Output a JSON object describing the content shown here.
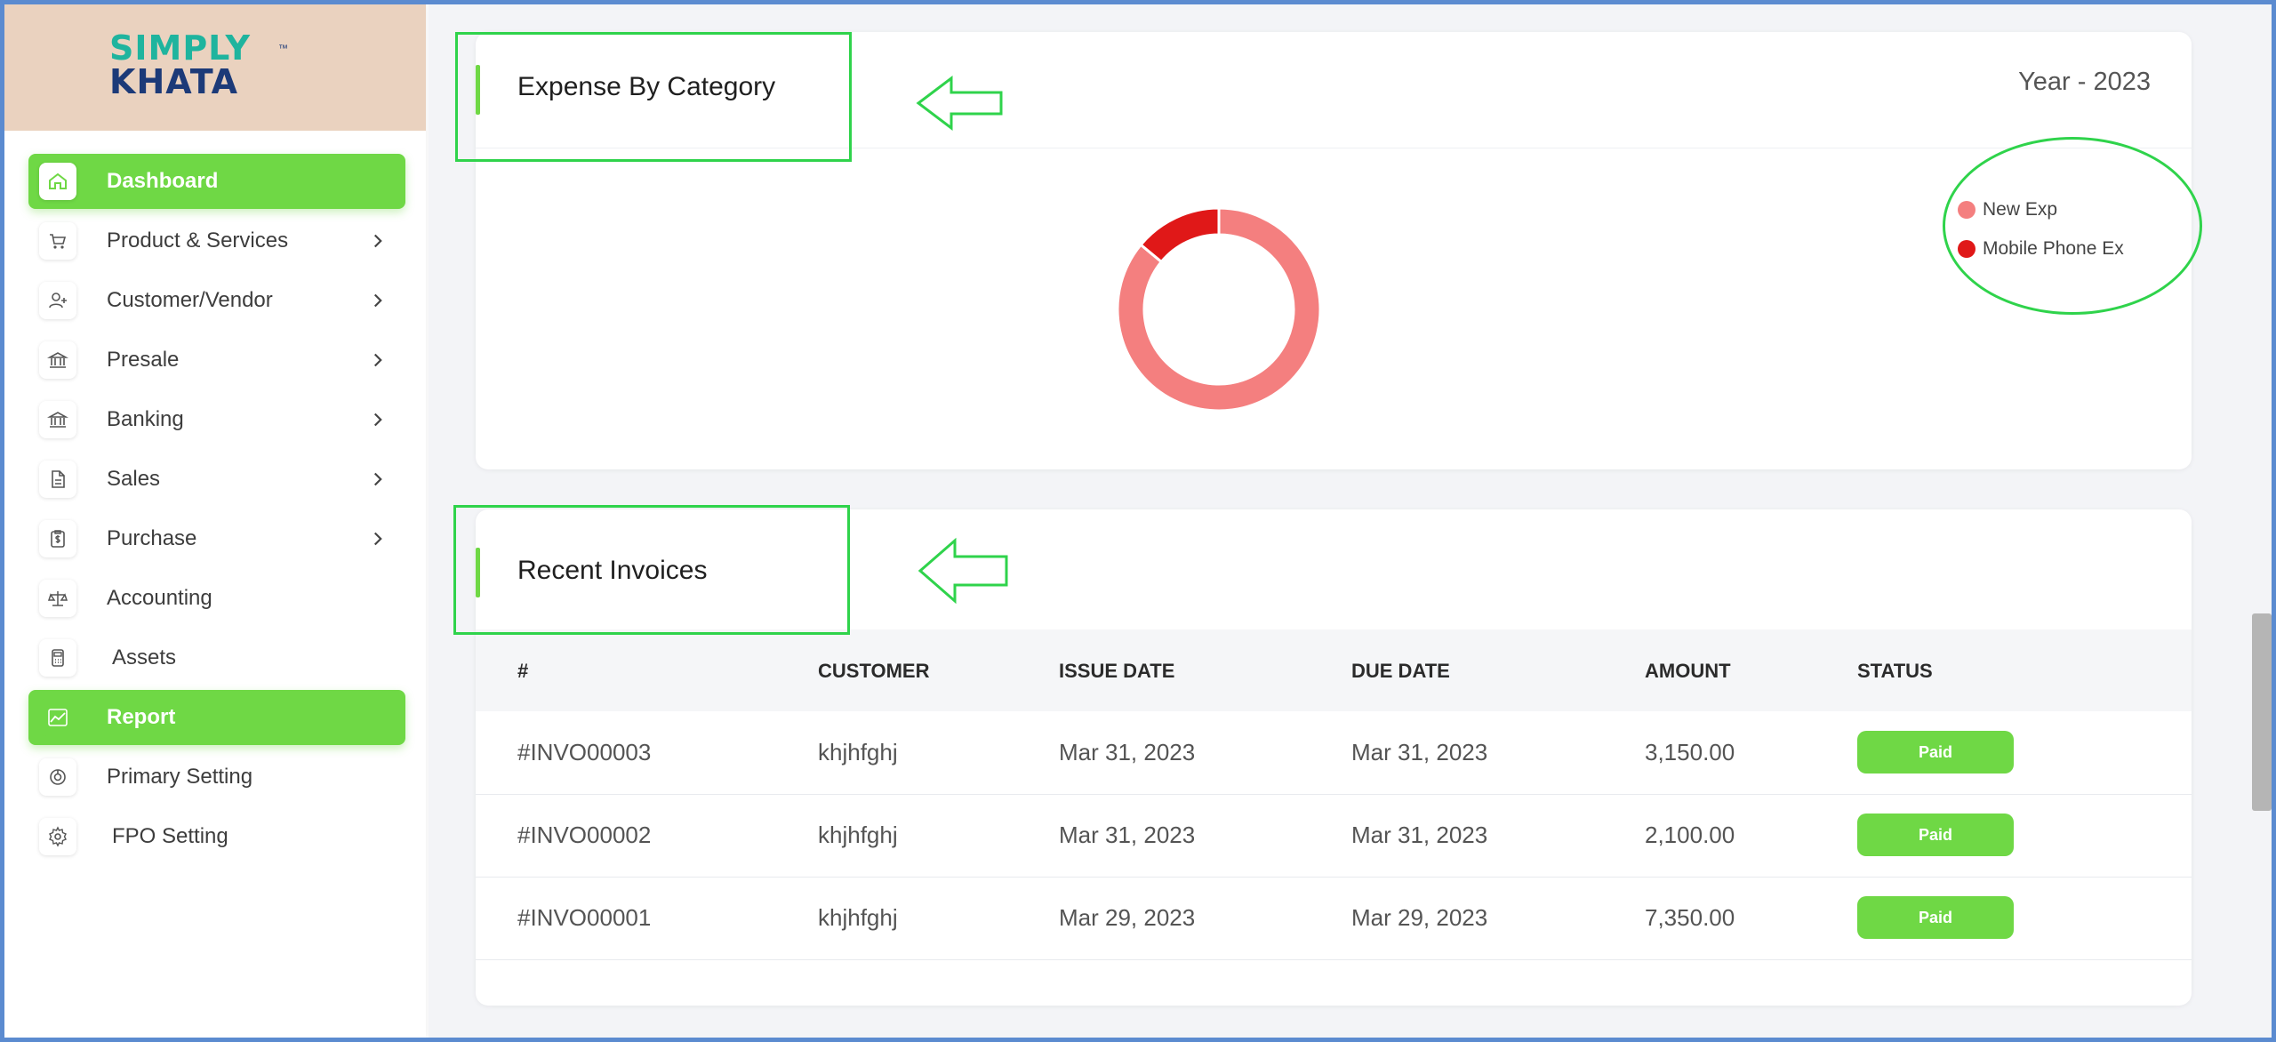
{
  "brand": {
    "line1": "SIMPLY",
    "line2": "KHATA",
    "tm": "™"
  },
  "sidebar": {
    "items": [
      {
        "label": "Dashboard",
        "icon": "home-icon",
        "active": true,
        "chevron": false
      },
      {
        "label": "Product & Services",
        "icon": "cart-icon",
        "active": false,
        "chevron": true
      },
      {
        "label": "Customer/Vendor",
        "icon": "user-plus-icon",
        "active": false,
        "chevron": true
      },
      {
        "label": "Presale",
        "icon": "bank-icon",
        "active": false,
        "chevron": true
      },
      {
        "label": "Banking",
        "icon": "bank-icon",
        "active": false,
        "chevron": true
      },
      {
        "label": "Sales",
        "icon": "document-icon",
        "active": false,
        "chevron": true
      },
      {
        "label": "Purchase",
        "icon": "clipboard-dollar-icon",
        "active": false,
        "chevron": true
      },
      {
        "label": "Accounting",
        "icon": "scale-icon",
        "active": false,
        "chevron": false
      },
      {
        "label": "Assets",
        "icon": "calculator-icon",
        "active": false,
        "chevron": false
      },
      {
        "label": "Report",
        "icon": "chart-icon",
        "active": true,
        "chevron": false
      },
      {
        "label": "Primary Setting",
        "icon": "settings-dial-icon",
        "active": false,
        "chevron": false
      },
      {
        "label": "FPO Setting",
        "icon": "gear-icon",
        "active": false,
        "chevron": false
      }
    ]
  },
  "expense_card": {
    "title": "Expense By Category",
    "year": "Year - 2023"
  },
  "chart_data": {
    "type": "pie",
    "series": [
      {
        "name": "New Exp",
        "value": 86,
        "color": "#f47f7f"
      },
      {
        "name": "Mobile Phone Ex",
        "value": 14,
        "color": "#e01818"
      }
    ]
  },
  "invoices_card": {
    "title": "Recent Invoices",
    "columns": [
      "#",
      "CUSTOMER",
      "ISSUE DATE",
      "DUE DATE",
      "AMOUNT",
      "STATUS"
    ],
    "rows": [
      {
        "id": "#INVO00003",
        "customer": "khjhfghj",
        "issue": "Mar 31, 2023",
        "due": "Mar 31, 2023",
        "amount": "3,150.00",
        "status": "Paid"
      },
      {
        "id": "#INVO00002",
        "customer": "khjhfghj",
        "issue": "Mar 31, 2023",
        "due": "Mar 31, 2023",
        "amount": "2,100.00",
        "status": "Paid"
      },
      {
        "id": "#INVO00001",
        "customer": "khjhfghj",
        "issue": "Mar 29, 2023",
        "due": "Mar 29, 2023",
        "amount": "7,350.00",
        "status": "Paid"
      }
    ]
  },
  "colors": {
    "accent": "#6fd845",
    "annotation": "#2fd34b"
  }
}
